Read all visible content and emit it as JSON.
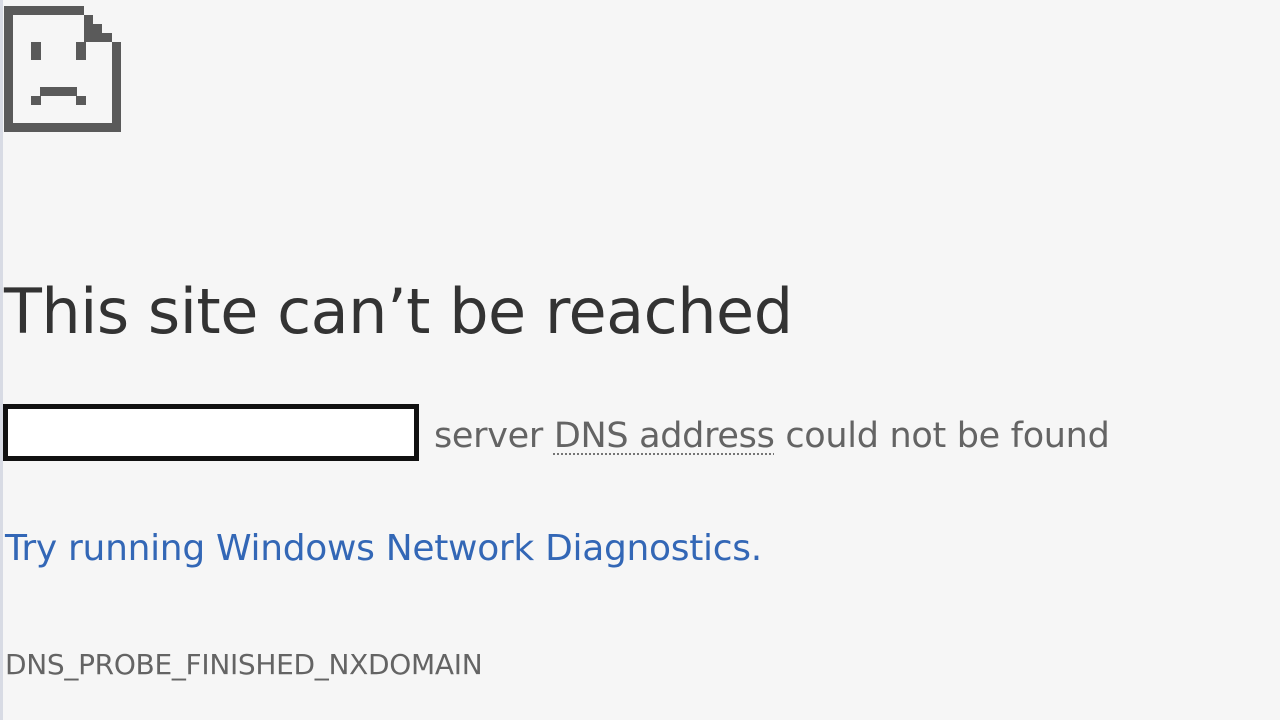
{
  "page": {
    "icon": "sad-page-icon",
    "headline": "This site can’t be reached",
    "summary": {
      "text_before_term": "server ",
      "term": "DNS address",
      "text_after_term": " could not be found"
    },
    "diagnostics_link": "Try running Windows Network Diagnostics.",
    "error_code": "DNS_PROBE_FINISHED_NXDOMAIN"
  },
  "colors": {
    "background": "#f6f6f6",
    "icon": "#5a5a5a",
    "headline": "#333333",
    "body_text": "#646464",
    "link": "#3367b6",
    "redaction_border": "#111111",
    "redaction_fill": "#ffffff"
  }
}
